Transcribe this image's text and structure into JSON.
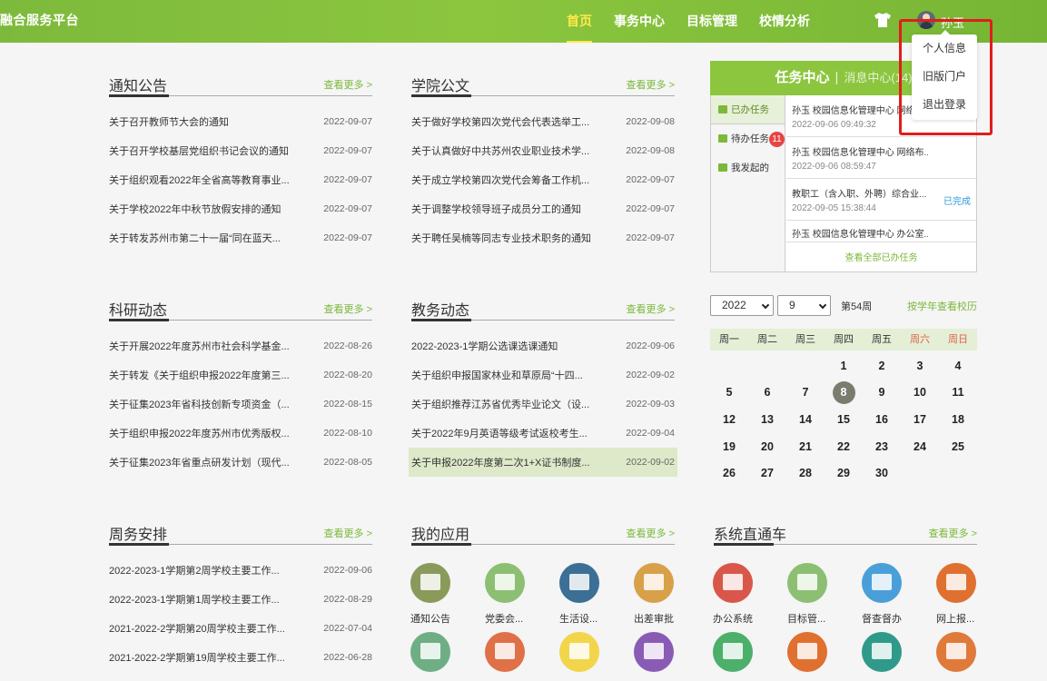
{
  "header": {
    "brand": "融合服务平台",
    "nav": [
      "首页",
      "事务中心",
      "目标管理",
      "校情分析"
    ],
    "user_name": "孙玉"
  },
  "dropdown": [
    "个人信息",
    "旧版门户",
    "退出登录"
  ],
  "more_label": "查看更多 >",
  "notice": {
    "title": "通知公告",
    "rows": [
      {
        "t": "关于召开教师节大会的通知",
        "d": "2022-09-07"
      },
      {
        "t": "关于召开学校基层党组织书记会议的通知",
        "d": "2022-09-07"
      },
      {
        "t": "关于组织观看2022年全省高等教育事业...",
        "d": "2022-09-07"
      },
      {
        "t": "关于学校2022年中秋节放假安排的通知",
        "d": "2022-09-07"
      },
      {
        "t": "关于转发苏州市第二十一届“同在蓝天...",
        "d": "2022-09-07"
      }
    ]
  },
  "docs": {
    "title": "学院公文",
    "rows": [
      {
        "t": "关于做好学校第四次党代会代表选举工...",
        "d": "2022-09-08"
      },
      {
        "t": "关于认真做好中共苏州农业职业技术学...",
        "d": "2022-09-08"
      },
      {
        "t": "关于成立学校第四次党代会筹备工作机...",
        "d": "2022-09-07"
      },
      {
        "t": "关于调整学校领导班子成员分工的通知",
        "d": "2022-09-07"
      },
      {
        "t": "关于聘任吴楠等同志专业技术职务的通知",
        "d": "2022-09-07"
      }
    ]
  },
  "research": {
    "title": "科研动态",
    "rows": [
      {
        "t": "关于开展2022年度苏州市社会科学基金...",
        "d": "2022-08-26"
      },
      {
        "t": "关于转发《关于组织申报2022年度第三...",
        "d": "2022-08-20"
      },
      {
        "t": "关于征集2023年省科技创新专项资金（...",
        "d": "2022-08-15"
      },
      {
        "t": "关于组织申报2022年度苏州市优秀版权...",
        "d": "2022-08-10"
      },
      {
        "t": "关于征集2023年省重点研发计划（现代...",
        "d": "2022-08-05"
      }
    ]
  },
  "academic": {
    "title": "教务动态",
    "rows": [
      {
        "t": "2022-2023-1学期公选课选课通知",
        "d": "2022-09-06"
      },
      {
        "t": "关于组织申报国家林业和草原局“十四...",
        "d": "2022-09-02"
      },
      {
        "t": "关于组织推荐江苏省优秀毕业论文（设...",
        "d": "2022-09-03"
      },
      {
        "t": "关于2022年9月英语等级考试返校考生...",
        "d": "2022-09-04"
      },
      {
        "t": "关于申报2022年度第二次1+X证书制度...",
        "d": "2022-09-02"
      }
    ]
  },
  "weekly": {
    "title": "周务安排",
    "rows": [
      {
        "t": "2022-2023-1学期第2周学校主要工作...",
        "d": "2022-09-06"
      },
      {
        "t": "2022-2023-1学期第1周学校主要工作...",
        "d": "2022-08-29"
      },
      {
        "t": "2021-2022-2学期第20周学校主要工作...",
        "d": "2022-07-04"
      },
      {
        "t": "2021-2022-2学期第19周学校主要工作...",
        "d": "2022-06-28"
      }
    ]
  },
  "my_apps": {
    "title": "我的应用",
    "items": [
      {
        "label": "通知公告",
        "color": "#8a9a5b"
      },
      {
        "label": "党委会...",
        "color": "#8dbf73"
      },
      {
        "label": "生活设...",
        "color": "#3b6f96"
      },
      {
        "label": "出差审批",
        "color": "#d9a04a"
      },
      {
        "label": "",
        "color": "#6fae84"
      },
      {
        "label": "",
        "color": "#e07047"
      },
      {
        "label": "",
        "color": "#f2d54a"
      },
      {
        "label": "",
        "color": "#8a5bb5"
      }
    ]
  },
  "systems": {
    "title": "系统直通车",
    "items": [
      {
        "label": "办公系统",
        "color": "#d9574a"
      },
      {
        "label": "目标管...",
        "color": "#8dbf73"
      },
      {
        "label": "督查督办",
        "color": "#4a9fd9"
      },
      {
        "label": "网上报...",
        "color": "#e0702f"
      },
      {
        "label": "",
        "color": "#4caf6a"
      },
      {
        "label": "",
        "color": "#e0702f"
      },
      {
        "label": "",
        "color": "#2f9a8a"
      },
      {
        "label": "",
        "color": "#e07a3a"
      }
    ]
  },
  "task_center": {
    "title": "任务中心",
    "sep": "|",
    "msg": "消息中心(14)",
    "tabs": [
      {
        "label": "已办任务"
      },
      {
        "label": "待办任务",
        "badge": "11"
      },
      {
        "label": "我发起的"
      }
    ],
    "items": [
      {
        "title": "孙玉 校园信息化管理中心 网络布...",
        "date": "2022-09-06 09:49:32",
        "status": ""
      },
      {
        "title": "孙玉 校园信息化管理中心 网络布...",
        "date": "2022-09-06 08:59:47",
        "status": ""
      },
      {
        "title": "教职工（含入职、外聘）综合业...",
        "date": "2022-09-05 15:38:44",
        "status": "已完成"
      },
      {
        "title": "孙玉 校园信息化管理中心 办公室...",
        "date": "",
        "status": ""
      }
    ],
    "view_all": "查看全部已办任务"
  },
  "calendar": {
    "year": "2022",
    "month": "9",
    "week_no": "第54周",
    "link": "按学年查看校历",
    "weekdays": [
      "周一",
      "周二",
      "周三",
      "周四",
      "周五",
      "周六",
      "周日"
    ],
    "days": [
      "",
      "",
      "",
      "1",
      "2",
      "3",
      "4",
      "5",
      "6",
      "7",
      "8",
      "9",
      "10",
      "11",
      "12",
      "13",
      "14",
      "15",
      "16",
      "17",
      "18",
      "19",
      "20",
      "21",
      "22",
      "23",
      "24",
      "25",
      "26",
      "27",
      "28",
      "29",
      "30"
    ],
    "today": "8"
  }
}
